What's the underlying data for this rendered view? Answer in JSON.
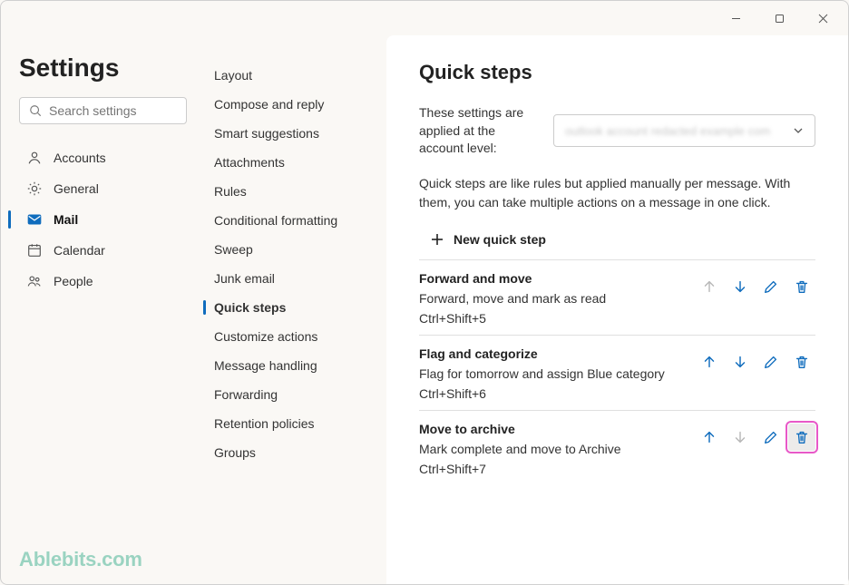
{
  "window": {
    "minimize": "—",
    "maximize": "▢",
    "close": "✕"
  },
  "settings": {
    "title": "Settings",
    "search_placeholder": "Search settings",
    "nav": [
      {
        "id": "accounts",
        "label": "Accounts",
        "active": false
      },
      {
        "id": "general",
        "label": "General",
        "active": false
      },
      {
        "id": "mail",
        "label": "Mail",
        "active": true
      },
      {
        "id": "calendar",
        "label": "Calendar",
        "active": false
      },
      {
        "id": "people",
        "label": "People",
        "active": false
      }
    ]
  },
  "subnav": {
    "items": [
      {
        "label": "Layout",
        "active": false
      },
      {
        "label": "Compose and reply",
        "active": false
      },
      {
        "label": "Smart suggestions",
        "active": false
      },
      {
        "label": "Attachments",
        "active": false
      },
      {
        "label": "Rules",
        "active": false
      },
      {
        "label": "Conditional formatting",
        "active": false
      },
      {
        "label": "Sweep",
        "active": false
      },
      {
        "label": "Junk email",
        "active": false
      },
      {
        "label": "Quick steps",
        "active": true
      },
      {
        "label": "Customize actions",
        "active": false
      },
      {
        "label": "Message handling",
        "active": false
      },
      {
        "label": "Forwarding",
        "active": false
      },
      {
        "label": "Retention policies",
        "active": false
      },
      {
        "label": "Groups",
        "active": false
      }
    ]
  },
  "page": {
    "title": "Quick steps",
    "account_label": "These settings are applied at the account level:",
    "account_value": "outlook account redacted example com",
    "description": "Quick steps are like rules but applied manually per message. With them, you can take multiple actions on a message in one click.",
    "new_step_label": "New quick step"
  },
  "steps": [
    {
      "title": "Forward and move",
      "desc": "Forward, move and mark as read",
      "shortcut": "Ctrl+Shift+5",
      "up_disabled": true,
      "down_disabled": false,
      "highlight_delete": false
    },
    {
      "title": "Flag and categorize",
      "desc": "Flag for tomorrow and assign Blue category",
      "shortcut": "Ctrl+Shift+6",
      "up_disabled": false,
      "down_disabled": false,
      "highlight_delete": false
    },
    {
      "title": "Move to archive",
      "desc": "Mark complete and move to Archive",
      "shortcut": "Ctrl+Shift+7",
      "up_disabled": false,
      "down_disabled": true,
      "highlight_delete": true
    }
  ],
  "watermark": "Ablebits.com"
}
